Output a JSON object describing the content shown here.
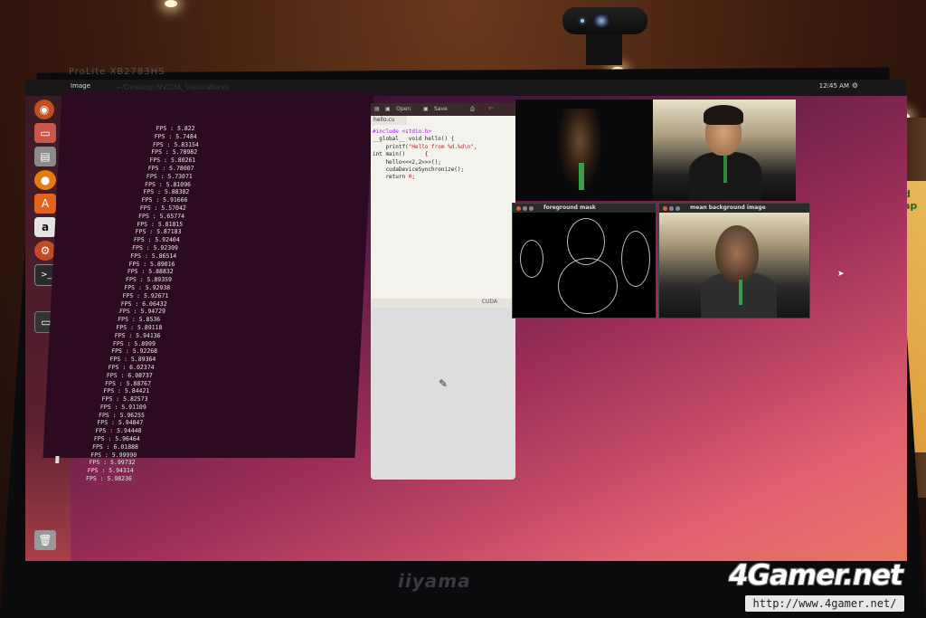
{
  "monitor": {
    "label": "ProLite XB2783HS",
    "brand": "iiyama"
  },
  "topbar": {
    "app_name": "Image",
    "title_ghost": "~/Desktop/NVIDIA_VisionWorks",
    "clock": "12:45 AM",
    "network_icon": "wifi-icon",
    "settings_icon": "gear-icon"
  },
  "launcher": {
    "items": [
      "ubuntu-icon",
      "files-icon",
      "store-icon",
      "firefox-icon",
      "software-center-icon",
      "amazon-icon",
      "settings-icon",
      "terminal-icon",
      "text-editor-icon",
      "display-icon",
      "trash-icon"
    ]
  },
  "terminal": {
    "fps_lines": [
      "FPS : 5.822",
      "FPS : 5.7484",
      "FPS : 5.83154",
      "FPS : 5.78982",
      "FPS : 5.80261",
      "FPS : 5.78007",
      "FPS : 5.73071",
      "FPS : 5.81096",
      "FPS : 5.88302",
      "FPS : 5.91666",
      "FPS : 5.57042",
      "FPS : 5.65774",
      "FPS : 5.81815",
      "FPS : 5.87183",
      "FPS : 5.92404",
      "FPS : 5.92399",
      "FPS : 5.86514",
      "FPS : 5.89016",
      "FPS : 5.88832",
      "FPS : 5.89359",
      "FPS : 5.92938",
      "FPS : 5.92671",
      "FPS : 6.06432",
      "FPS : 5.94729",
      "FPS : 5.8536",
      "FPS : 5.89118",
      "FPS : 5.94136",
      "FPS : 5.8999",
      "FPS : 5.92268",
      "FPS : 5.89364",
      "FPS : 6.02374",
      "FPS : 6.08737",
      "FPS : 5.88767",
      "FPS : 5.84421",
      "FPS : 5.82573",
      "FPS : 5.91109",
      "FPS : 5.96255",
      "FPS : 5.94847",
      "FPS : 5.94448",
      "FPS : 5.96464",
      "FPS : 6.01888",
      "FPS : 5.99990",
      "FPS : 5.99732",
      "FPS : 5.94314",
      "FPS : 5.98236"
    ]
  },
  "editor": {
    "tab_name": "hello.cu",
    "toolbar": {
      "open": "Open",
      "save": "Save"
    },
    "code": [
      {
        "pre": "",
        "kw": "#include <stdio.h>",
        "post": ""
      },
      {
        "pre": "",
        "kw": "",
        "post": ""
      },
      {
        "pre": "__global__ void hello() {",
        "kw": "",
        "post": ""
      },
      {
        "pre": "    printf(",
        "kw": "\"Hello from %d.%d\\n\"",
        "post": ","
      },
      {
        "pre": "",
        "kw": "",
        "post": ""
      },
      {
        "pre": "",
        "kw": "",
        "post": ""
      },
      {
        "pre": "int main()      {",
        "kw": "",
        "post": ""
      },
      {
        "pre": "    hello<<<2,2>>>();",
        "kw": "",
        "post": ""
      },
      {
        "pre": "    cudaDeviceSynchronize();",
        "kw": "",
        "post": ""
      },
      {
        "pre": "    return ",
        "kw": "0",
        "post": ";"
      }
    ],
    "language": "CUDA"
  },
  "windows": {
    "foreground_mask": {
      "title": "foreground mask"
    },
    "mean_background": {
      "title": "mean background image"
    }
  },
  "watermark": {
    "logo": "4Gamer.net",
    "url": "http://www.4gamer.net/"
  }
}
